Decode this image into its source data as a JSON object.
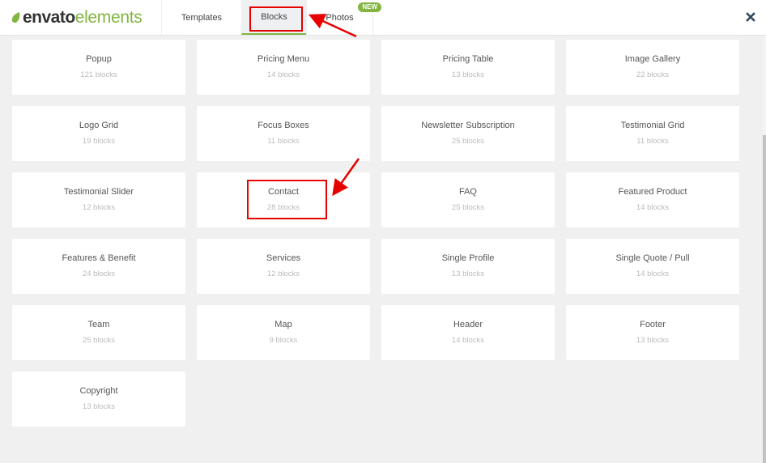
{
  "header": {
    "logo": {
      "brand_bold": "envato",
      "brand_light": "elements",
      "icon": "leaf-icon",
      "brand_color": "#82b541"
    },
    "tabs": [
      {
        "label": "Templates",
        "active": false
      },
      {
        "label": "Blocks",
        "active": true
      },
      {
        "label": "Photos",
        "active": false,
        "badge": "NEW"
      }
    ],
    "close_icon": "close-icon"
  },
  "blocks": [
    {
      "title": "Popup",
      "count": "121 blocks"
    },
    {
      "title": "Pricing Menu",
      "count": "14 blocks"
    },
    {
      "title": "Pricing Table",
      "count": "13 blocks"
    },
    {
      "title": "Image Gallery",
      "count": "22 blocks"
    },
    {
      "title": "Logo Grid",
      "count": "19 blocks"
    },
    {
      "title": "Focus Boxes",
      "count": "11 blocks"
    },
    {
      "title": "Newsletter Subscription",
      "count": "25 blocks"
    },
    {
      "title": "Testimonial Grid",
      "count": "11 blocks"
    },
    {
      "title": "Testimonial Slider",
      "count": "12 blocks"
    },
    {
      "title": "Contact",
      "count": "28 blocks"
    },
    {
      "title": "FAQ",
      "count": "25 blocks"
    },
    {
      "title": "Featured Product",
      "count": "14 blocks"
    },
    {
      "title": "Features & Benefit",
      "count": "24 blocks"
    },
    {
      "title": "Services",
      "count": "12 blocks"
    },
    {
      "title": "Single Profile",
      "count": "13 blocks"
    },
    {
      "title": "Single Quote / Pull",
      "count": "14 blocks"
    },
    {
      "title": "Team",
      "count": "25 blocks"
    },
    {
      "title": "Map",
      "count": "9 blocks"
    },
    {
      "title": "Header",
      "count": "14 blocks"
    },
    {
      "title": "Footer",
      "count": "13 blocks"
    },
    {
      "title": "Copyright",
      "count": "13 blocks"
    }
  ],
  "annotations": {
    "color": "#e60000",
    "highlighted": [
      "Blocks tab",
      "Contact block"
    ]
  }
}
